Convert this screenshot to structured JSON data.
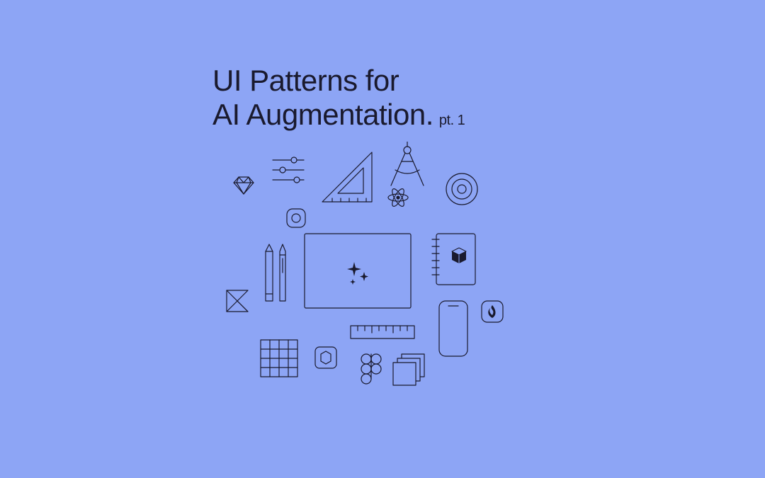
{
  "title": {
    "line1": "UI Patterns for",
    "line2": "AI Augmentation.",
    "part": "pt. 1"
  },
  "colors": {
    "background": "#8da5f5",
    "stroke": "#1a1a2e"
  },
  "icons": [
    "diamond-icon",
    "sliders-icon",
    "set-square-icon",
    "compass-icon",
    "atom-icon",
    "target-icon",
    "rounded-square-icon",
    "pen-icon",
    "pencil-icon",
    "screen-icon",
    "sparkles-icon",
    "notebook-icon",
    "cube-icon",
    "arrow-corner-icon",
    "grid-icon",
    "hexagon-badge-icon",
    "ruler-icon",
    "figma-logo-icon",
    "stacked-squares-icon",
    "phone-icon",
    "flame-badge-icon"
  ]
}
